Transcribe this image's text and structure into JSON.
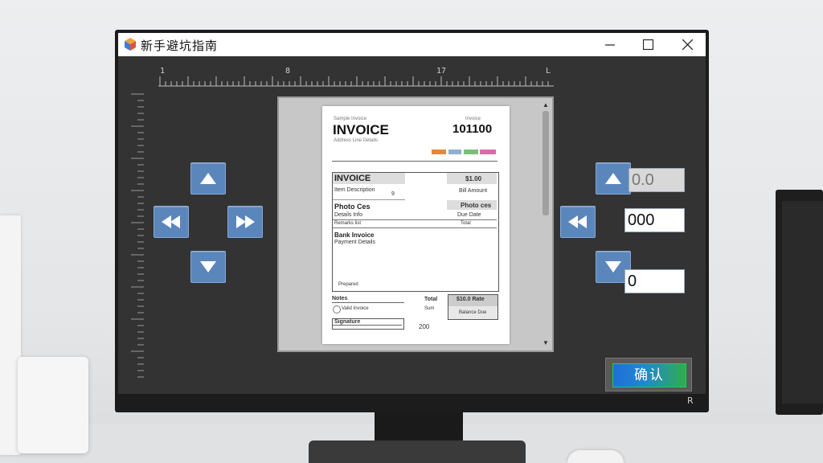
{
  "window": {
    "title": "新手避坑指南",
    "controls": [
      "minimize",
      "maximize",
      "close"
    ]
  },
  "ruler": {
    "labels": [
      "1",
      "8",
      "17",
      "L"
    ]
  },
  "invoice_preview": {
    "header_small": "Sample Invoice",
    "title": "INVOICE",
    "subtitle_small": "Address Line Details",
    "number_label": "Invoice",
    "number": "101100",
    "tags": [
      "#e3893a",
      "#8fb0d0",
      "#7ac07a",
      "#d86ca8"
    ],
    "table_header_left": "INVOICE",
    "table_header_right": "$1.00",
    "row1_left": "Item Description",
    "row1_mid": "9",
    "row1_right": "Bill Amount",
    "section2_left": "Photo Ces",
    "section2_right": "Photo ces",
    "row2_left": "Details Info",
    "row2_right": "Due Date",
    "row3_left": "Remarks list",
    "row3_right": "Total",
    "section3_title": "Bank Invoice",
    "section3_sub": "Payment Details",
    "footer_left": "Prepared",
    "summary_label": "Notes",
    "summary_line": "Valid Invoice",
    "summary_box_left": "Total",
    "summary_box_right": "$10.0 Rate",
    "summary_sub_left": "Sum",
    "summary_sub_right": "Balance Due",
    "signature_label": "Signature",
    "page_total": "200"
  },
  "right_panel": {
    "field_top": "0.0",
    "field_mid": "000",
    "field_bottom": "0"
  },
  "confirm_button": {
    "label": "确认"
  },
  "corner_mark": "R"
}
